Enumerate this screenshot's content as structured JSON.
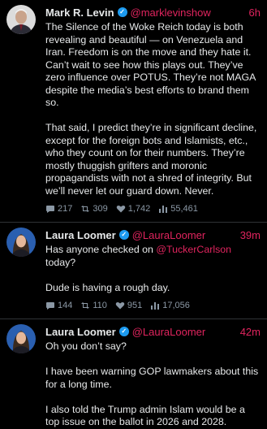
{
  "posts": [
    {
      "name": "Mark R. Levin",
      "handle": "@marklevinshow",
      "time": "6h",
      "paragraphs": [
        "The Silence of the Woke Reich today is both revealing and beautiful — on Venezuela and Iran. Freedom is on the move and they hate it. Can’t wait to see how this plays out. They’ve zero influence over POTUS.  They’re not MAGA despite the media’s best efforts to brand them so.",
        "That said, I predict they’re in significant decline, except for the foreign bots and Islamists, etc., who they count on for their numbers.  They’re mostly thuggish grifters and moronic propagandists with not a shred of integrity. But we’ll never let our guard down. Never."
      ],
      "replies": "217",
      "reposts": "309",
      "likes": "1,742",
      "views": "55,461"
    },
    {
      "name": "Laura Loomer",
      "handle": "@LauraLoomer",
      "time": "39m",
      "line1_prefix": "Has anyone checked on ",
      "mention": "@TuckerCarlson",
      "line1_suffix": " today?",
      "line2": "Dude is having a rough day.",
      "replies": "144",
      "reposts": "110",
      "likes": "951",
      "views": "17,056"
    },
    {
      "name": "Laura Loomer",
      "handle": "@LauraLoomer",
      "time": "42m",
      "paragraphs": [
        "Oh you don’t say?",
        "I have been warning GOP lawmakers about this for a long time.",
        "I also told the Trump admin Islam would be a top issue on the ballot in 2026 and 2028."
      ]
    }
  ],
  "icons": {
    "verified": "verified-badge-icon",
    "reply": "comment-icon",
    "repost": "repost-icon",
    "like": "heart-icon",
    "views": "views-bar-chart-icon"
  },
  "colors": {
    "background": "#000000",
    "text": "#e7e9ea",
    "accent": "#e0245e",
    "verified": "#1d9bf0",
    "muted": "#8b98a5",
    "divider": "#2f3336"
  }
}
